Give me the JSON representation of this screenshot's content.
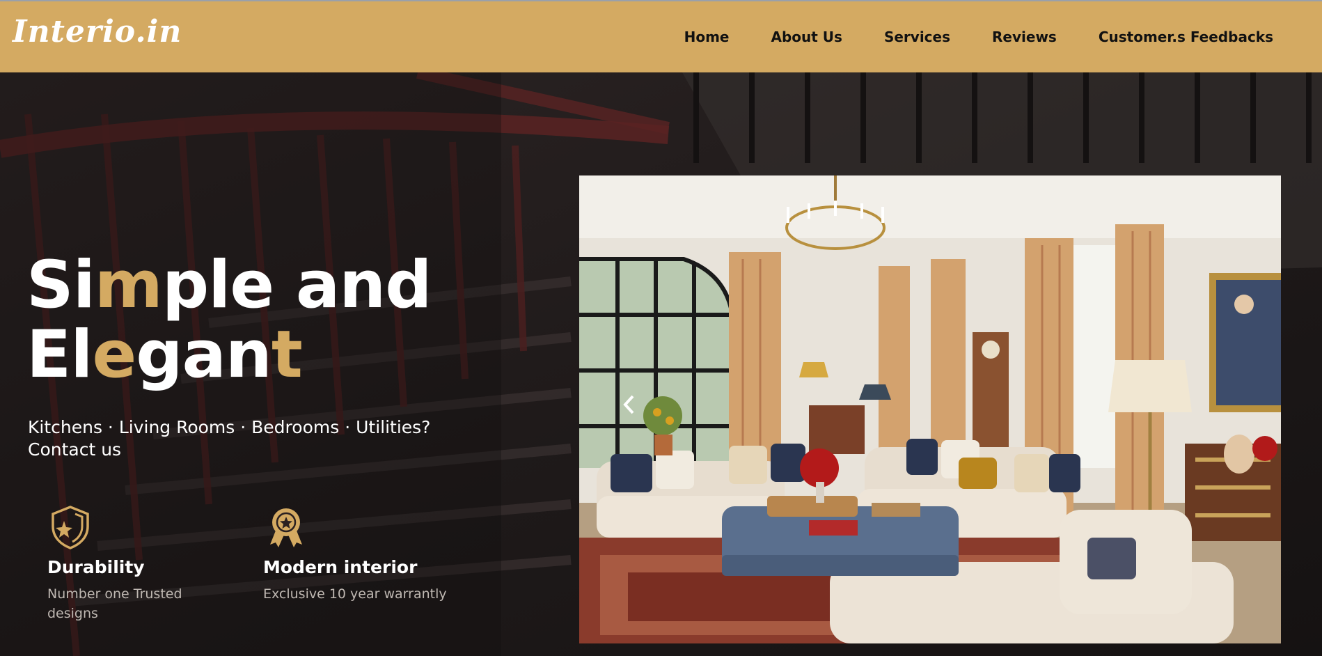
{
  "brand": {
    "logo_text": "Interio.in"
  },
  "nav": {
    "items": [
      "Home",
      "About Us",
      "Services",
      "Reviews",
      "Customer.s Feedbacks"
    ]
  },
  "hero": {
    "headline": {
      "line1": {
        "w1": "Si",
        "w2": "m",
        "w3": "ple and"
      },
      "line2": {
        "w1": "El",
        "w2": "e",
        "w3": "gan",
        "w4": "t"
      }
    },
    "subline": "Kitchens · Living Rooms · Bedrooms · Utilities? Contact us",
    "features": [
      {
        "icon": "shield-star-icon",
        "title": "Durability",
        "description": "Number one Trusted designs"
      },
      {
        "icon": "award-ribbon-icon",
        "title": "Modern interior",
        "description": "Exclusive 10 year warrantly"
      }
    ]
  },
  "carousel": {
    "prev_icon": "chevron-left-icon"
  },
  "colors": {
    "navbar_bg": "#d4aa62",
    "accent_gold": "#d4aa62",
    "hero_bg": "#1e1818",
    "text_white": "#ffffff",
    "text_muted": "#bfb8b2"
  }
}
